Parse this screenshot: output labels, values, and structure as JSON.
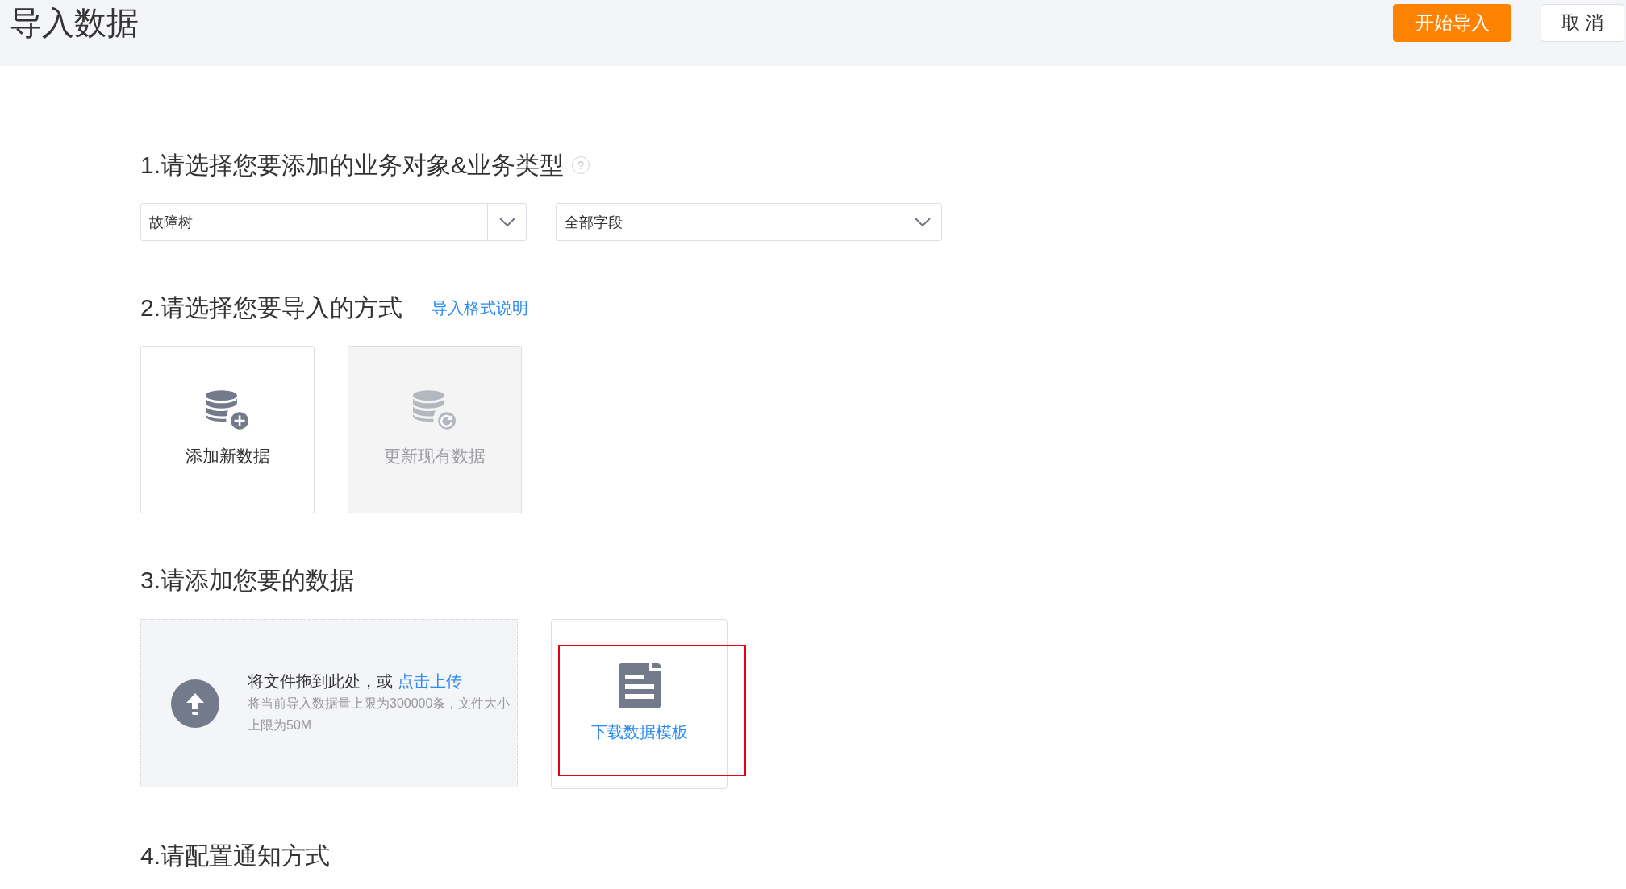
{
  "header": {
    "title": "导入数据",
    "buttons": [
      {
        "label": "开始导入",
        "kind": "primary"
      },
      {
        "label": "取 消",
        "kind": "default"
      }
    ]
  },
  "sections": [
    {
      "kind": "selects",
      "title": "1.请选择您要添加的业务对象&业务类型",
      "help": "?",
      "selects": [
        {
          "value": "故障树"
        },
        {
          "value": "全部字段"
        }
      ]
    },
    {
      "kind": "methods",
      "title": "2.请选择您要导入的方式",
      "link": "导入格式说明",
      "methods": [
        {
          "label": "添加新数据",
          "kind": "add",
          "disabled": false
        },
        {
          "label": "更新现有数据",
          "kind": "update",
          "disabled": true
        }
      ]
    },
    {
      "kind": "upload",
      "title": "3.请添加您要的数据",
      "upload": {
        "text": "将文件拖到此处，或 ",
        "link": "点击上传",
        "hint": "将当前导入数据量上限为300000条，文件大小上限为50M"
      },
      "template": {
        "label": "下载数据模板",
        "highlighted": true
      }
    },
    {
      "kind": "plain",
      "title": "4.请配置通知方式"
    }
  ]
}
